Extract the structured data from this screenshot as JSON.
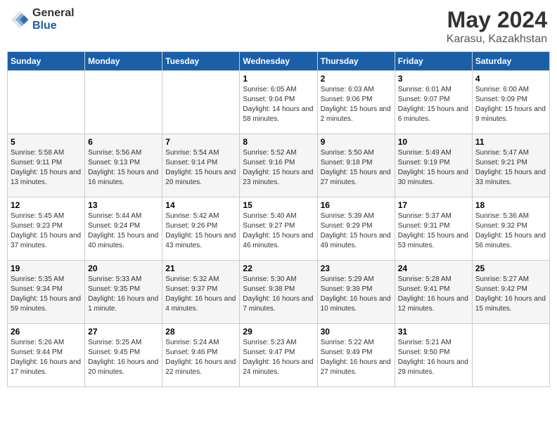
{
  "header": {
    "logo_general": "General",
    "logo_blue": "Blue",
    "title": "May 2024",
    "subtitle": "Karasu, Kazakhstan"
  },
  "days_of_week": [
    "Sunday",
    "Monday",
    "Tuesday",
    "Wednesday",
    "Thursday",
    "Friday",
    "Saturday"
  ],
  "weeks": [
    [
      {
        "day": "",
        "sunrise": "",
        "sunset": "",
        "daylight": ""
      },
      {
        "day": "",
        "sunrise": "",
        "sunset": "",
        "daylight": ""
      },
      {
        "day": "",
        "sunrise": "",
        "sunset": "",
        "daylight": ""
      },
      {
        "day": "1",
        "sunrise": "Sunrise: 6:05 AM",
        "sunset": "Sunset: 9:04 PM",
        "daylight": "Daylight: 14 hours and 58 minutes."
      },
      {
        "day": "2",
        "sunrise": "Sunrise: 6:03 AM",
        "sunset": "Sunset: 9:06 PM",
        "daylight": "Daylight: 15 hours and 2 minutes."
      },
      {
        "day": "3",
        "sunrise": "Sunrise: 6:01 AM",
        "sunset": "Sunset: 9:07 PM",
        "daylight": "Daylight: 15 hours and 6 minutes."
      },
      {
        "day": "4",
        "sunrise": "Sunrise: 6:00 AM",
        "sunset": "Sunset: 9:09 PM",
        "daylight": "Daylight: 15 hours and 9 minutes."
      }
    ],
    [
      {
        "day": "5",
        "sunrise": "Sunrise: 5:58 AM",
        "sunset": "Sunset: 9:11 PM",
        "daylight": "Daylight: 15 hours and 13 minutes."
      },
      {
        "day": "6",
        "sunrise": "Sunrise: 5:56 AM",
        "sunset": "Sunset: 9:13 PM",
        "daylight": "Daylight: 15 hours and 16 minutes."
      },
      {
        "day": "7",
        "sunrise": "Sunrise: 5:54 AM",
        "sunset": "Sunset: 9:14 PM",
        "daylight": "Daylight: 15 hours and 20 minutes."
      },
      {
        "day": "8",
        "sunrise": "Sunrise: 5:52 AM",
        "sunset": "Sunset: 9:16 PM",
        "daylight": "Daylight: 15 hours and 23 minutes."
      },
      {
        "day": "9",
        "sunrise": "Sunrise: 5:50 AM",
        "sunset": "Sunset: 9:18 PM",
        "daylight": "Daylight: 15 hours and 27 minutes."
      },
      {
        "day": "10",
        "sunrise": "Sunrise: 5:49 AM",
        "sunset": "Sunset: 9:19 PM",
        "daylight": "Daylight: 15 hours and 30 minutes."
      },
      {
        "day": "11",
        "sunrise": "Sunrise: 5:47 AM",
        "sunset": "Sunset: 9:21 PM",
        "daylight": "Daylight: 15 hours and 33 minutes."
      }
    ],
    [
      {
        "day": "12",
        "sunrise": "Sunrise: 5:45 AM",
        "sunset": "Sunset: 9:23 PM",
        "daylight": "Daylight: 15 hours and 37 minutes."
      },
      {
        "day": "13",
        "sunrise": "Sunrise: 5:44 AM",
        "sunset": "Sunset: 9:24 PM",
        "daylight": "Daylight: 15 hours and 40 minutes."
      },
      {
        "day": "14",
        "sunrise": "Sunrise: 5:42 AM",
        "sunset": "Sunset: 9:26 PM",
        "daylight": "Daylight: 15 hours and 43 minutes."
      },
      {
        "day": "15",
        "sunrise": "Sunrise: 5:40 AM",
        "sunset": "Sunset: 9:27 PM",
        "daylight": "Daylight: 15 hours and 46 minutes."
      },
      {
        "day": "16",
        "sunrise": "Sunrise: 5:39 AM",
        "sunset": "Sunset: 9:29 PM",
        "daylight": "Daylight: 15 hours and 49 minutes."
      },
      {
        "day": "17",
        "sunrise": "Sunrise: 5:37 AM",
        "sunset": "Sunset: 9:31 PM",
        "daylight": "Daylight: 15 hours and 53 minutes."
      },
      {
        "day": "18",
        "sunrise": "Sunrise: 5:36 AM",
        "sunset": "Sunset: 9:32 PM",
        "daylight": "Daylight: 15 hours and 56 minutes."
      }
    ],
    [
      {
        "day": "19",
        "sunrise": "Sunrise: 5:35 AM",
        "sunset": "Sunset: 9:34 PM",
        "daylight": "Daylight: 15 hours and 59 minutes."
      },
      {
        "day": "20",
        "sunrise": "Sunrise: 5:33 AM",
        "sunset": "Sunset: 9:35 PM",
        "daylight": "Daylight: 16 hours and 1 minute."
      },
      {
        "day": "21",
        "sunrise": "Sunrise: 5:32 AM",
        "sunset": "Sunset: 9:37 PM",
        "daylight": "Daylight: 16 hours and 4 minutes."
      },
      {
        "day": "22",
        "sunrise": "Sunrise: 5:30 AM",
        "sunset": "Sunset: 9:38 PM",
        "daylight": "Daylight: 16 hours and 7 minutes."
      },
      {
        "day": "23",
        "sunrise": "Sunrise: 5:29 AM",
        "sunset": "Sunset: 9:39 PM",
        "daylight": "Daylight: 16 hours and 10 minutes."
      },
      {
        "day": "24",
        "sunrise": "Sunrise: 5:28 AM",
        "sunset": "Sunset: 9:41 PM",
        "daylight": "Daylight: 16 hours and 12 minutes."
      },
      {
        "day": "25",
        "sunrise": "Sunrise: 5:27 AM",
        "sunset": "Sunset: 9:42 PM",
        "daylight": "Daylight: 16 hours and 15 minutes."
      }
    ],
    [
      {
        "day": "26",
        "sunrise": "Sunrise: 5:26 AM",
        "sunset": "Sunset: 9:44 PM",
        "daylight": "Daylight: 16 hours and 17 minutes."
      },
      {
        "day": "27",
        "sunrise": "Sunrise: 5:25 AM",
        "sunset": "Sunset: 9:45 PM",
        "daylight": "Daylight: 16 hours and 20 minutes."
      },
      {
        "day": "28",
        "sunrise": "Sunrise: 5:24 AM",
        "sunset": "Sunset: 9:46 PM",
        "daylight": "Daylight: 16 hours and 22 minutes."
      },
      {
        "day": "29",
        "sunrise": "Sunrise: 5:23 AM",
        "sunset": "Sunset: 9:47 PM",
        "daylight": "Daylight: 16 hours and 24 minutes."
      },
      {
        "day": "30",
        "sunrise": "Sunrise: 5:22 AM",
        "sunset": "Sunset: 9:49 PM",
        "daylight": "Daylight: 16 hours and 27 minutes."
      },
      {
        "day": "31",
        "sunrise": "Sunrise: 5:21 AM",
        "sunset": "Sunset: 9:50 PM",
        "daylight": "Daylight: 16 hours and 29 minutes."
      },
      {
        "day": "",
        "sunrise": "",
        "sunset": "",
        "daylight": ""
      }
    ]
  ]
}
